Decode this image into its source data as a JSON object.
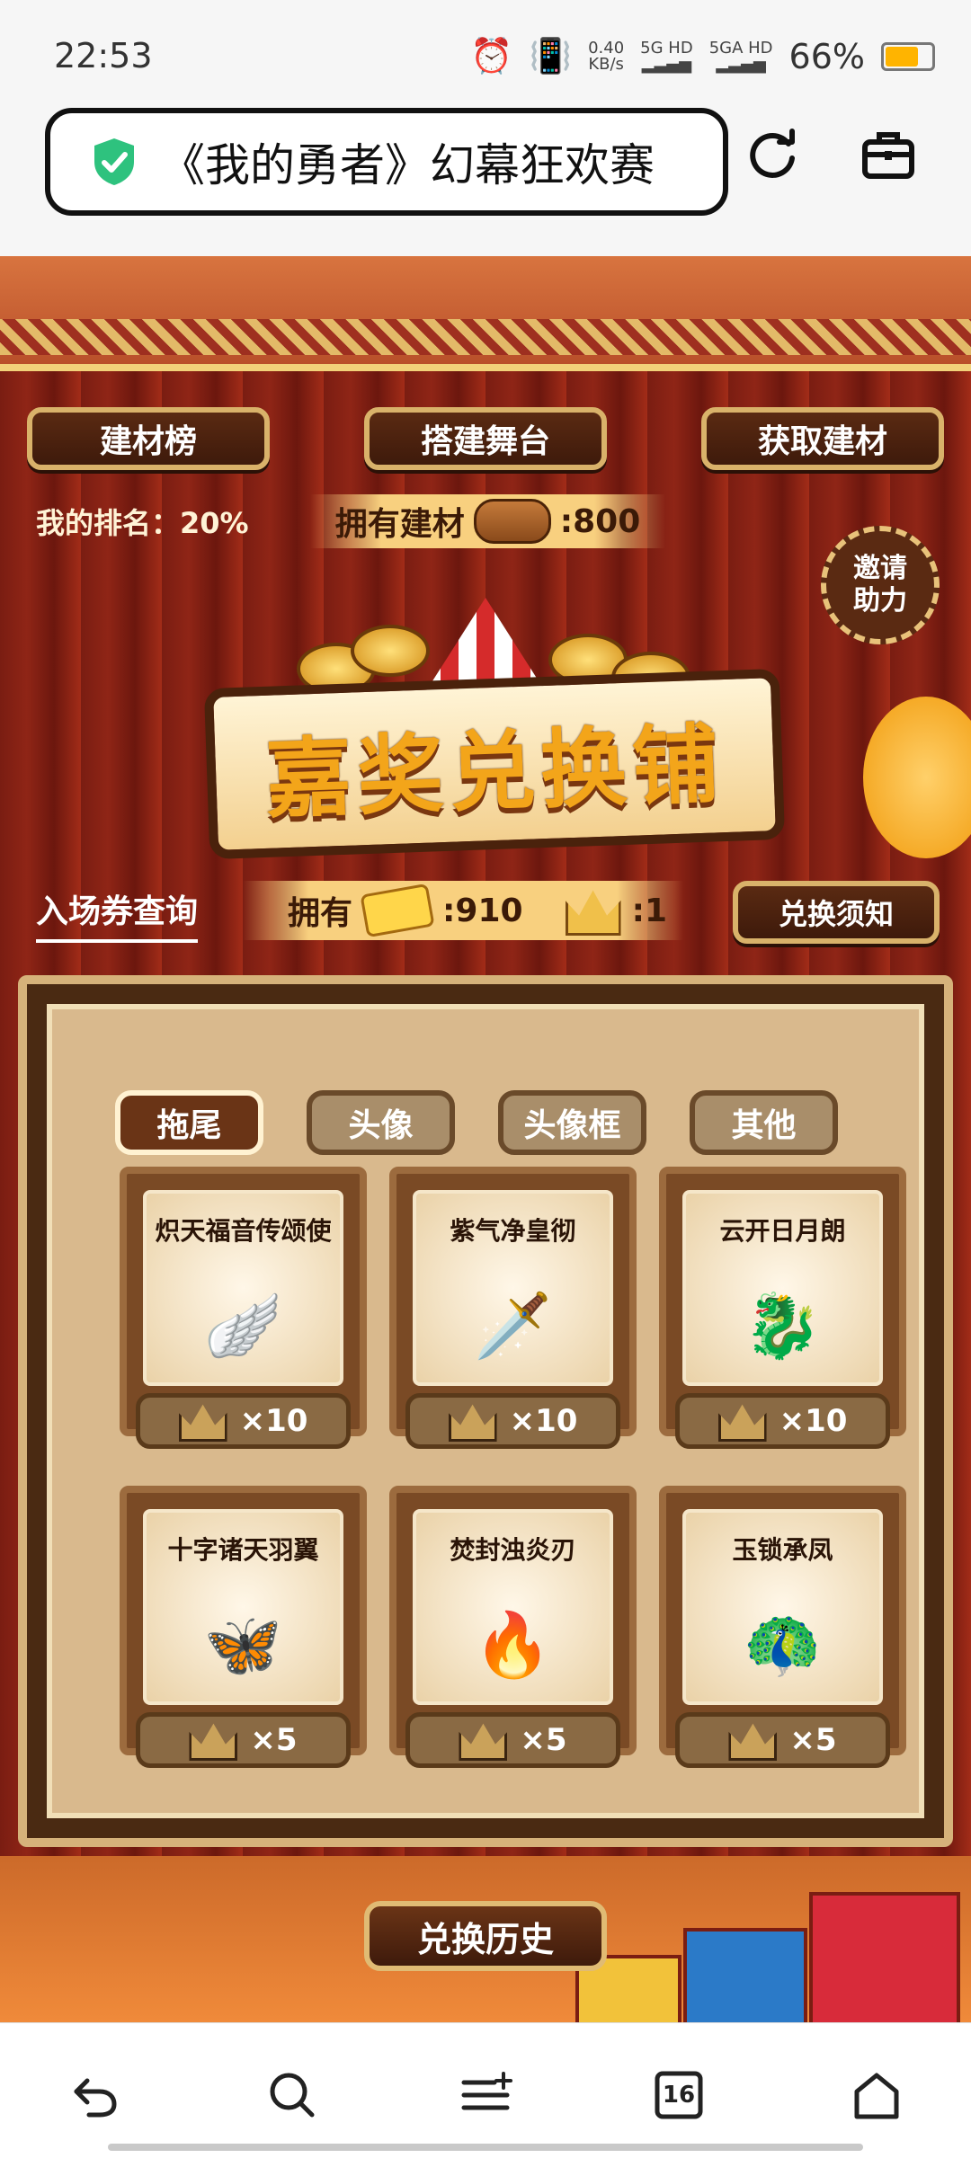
{
  "statusbar": {
    "time": "22:53",
    "net_speed": "0.40",
    "net_unit": "KB/s",
    "sig1": "5G HD",
    "sig2": "5GA HD",
    "battery": "66%"
  },
  "browser": {
    "title": "《我的勇者》幻幕狂欢赛"
  },
  "top_buttons": {
    "materials_rank": "建材榜",
    "build_stage": "搭建舞台",
    "get_materials": "获取建材"
  },
  "info": {
    "my_rank": "我的排名：20%",
    "owned_materials_label": "拥有建材",
    "owned_materials_value": ":800",
    "invite": "邀请\n助力",
    "banner": "嘉奖兑换铺",
    "ticket_query": "入场券查询",
    "owned_label": "拥有",
    "tickets_value": ":910",
    "crowns_value": ":1",
    "exchange_notice": "兑换须知"
  },
  "tabs": [
    {
      "label": "拖尾"
    },
    {
      "label": "头像"
    },
    {
      "label": "头像框"
    },
    {
      "label": "其他"
    }
  ],
  "items": [
    {
      "name": "炽天福音传颂使",
      "cost": "×10"
    },
    {
      "name": "紫气净皇彻",
      "cost": "×10"
    },
    {
      "name": "云开日月朗",
      "cost": "×10"
    },
    {
      "name": "十字诸天羽翼",
      "cost": "×5"
    },
    {
      "name": "焚封浊炎刃",
      "cost": "×5"
    },
    {
      "name": "玉锁承凤",
      "cost": "×5"
    }
  ],
  "history_button": "兑换历史",
  "navbar": {
    "tab_count": "16"
  }
}
